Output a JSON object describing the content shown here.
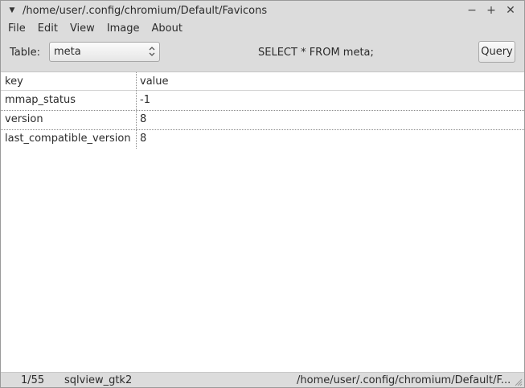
{
  "window": {
    "title": "/home/user/.config/chromium/Default/Favicons",
    "menu_icon": "window-menu-icon",
    "controls": [
      {
        "name": "minimize-icon",
        "glyph": "−"
      },
      {
        "name": "maximize-icon",
        "glyph": "+"
      },
      {
        "name": "close-icon",
        "glyph": "✕"
      }
    ]
  },
  "menubar": {
    "items": [
      "File",
      "Edit",
      "View",
      "Image",
      "About"
    ]
  },
  "toolbar": {
    "table_label": "Table:",
    "table_selected": "meta",
    "sql": "SELECT * FROM meta;",
    "query_label": "Query"
  },
  "grid": {
    "columns": [
      "key",
      "value"
    ],
    "rows": [
      [
        "mmap_status",
        "-1"
      ],
      [
        "version",
        "8"
      ],
      [
        "last_compatible_version",
        "8"
      ]
    ]
  },
  "statusbar": {
    "count": "1/55",
    "app": "sqlview_gtk2",
    "path": "/home/user/.config/chromium/Default/F..."
  }
}
